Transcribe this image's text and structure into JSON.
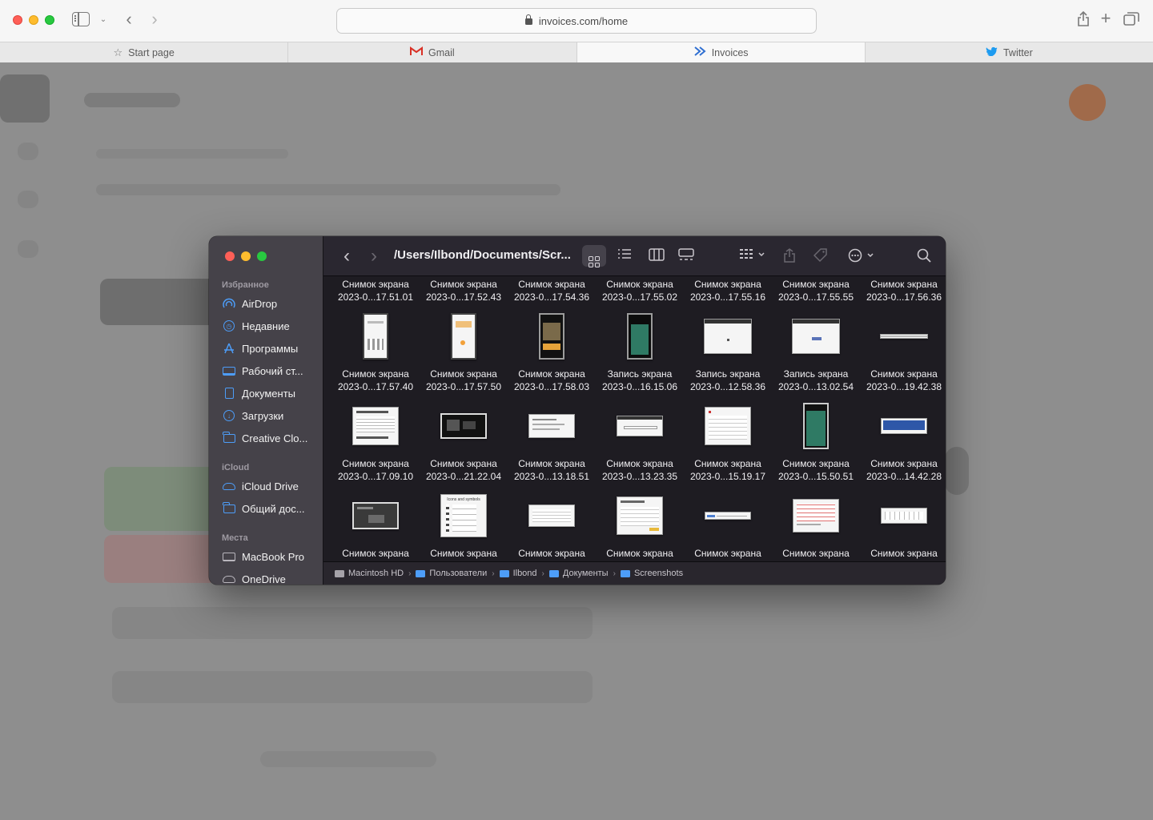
{
  "browser": {
    "url": "invoices.com/home",
    "tabs": [
      {
        "label": "Start page",
        "icon": "star-icon"
      },
      {
        "label": "Gmail",
        "icon": "gmail-icon"
      },
      {
        "label": "Invoices",
        "icon": "invoices-icon",
        "active": true
      },
      {
        "label": "Twitter",
        "icon": "twitter-icon"
      }
    ]
  },
  "finder": {
    "path_title": "/Users/Ilbond/Documents/Scr...",
    "sidebar": {
      "favorites_title": "Избранное",
      "favorites": [
        "AirDrop",
        "Недавние",
        "Программы",
        "Рабочий ст...",
        "Документы",
        "Загрузки",
        "Creative Clo..."
      ],
      "icloud_title": "iCloud",
      "icloud": [
        "iCloud Drive",
        "Общий дос..."
      ],
      "places_title": "Места",
      "places": [
        "MacBook Pro",
        "OneDrive"
      ]
    },
    "rows": [
      [
        {
          "title": "Снимок экрана",
          "sub": "2023-0...17.51.01"
        },
        {
          "title": "Снимок экрана",
          "sub": "2023-0...17.52.43"
        },
        {
          "title": "Снимок экрана",
          "sub": "2023-0...17.54.36"
        },
        {
          "title": "Снимок экрана",
          "sub": "2023-0...17.55.02"
        },
        {
          "title": "Снимок экрана",
          "sub": "2023-0...17.55.16"
        },
        {
          "title": "Снимок экрана",
          "sub": "2023-0...17.55.55"
        },
        {
          "title": "Снимок экрана",
          "sub": "2023-0...17.56.36"
        }
      ],
      [
        {
          "title": "Снимок экрана",
          "sub": "2023-0...17.57.40"
        },
        {
          "title": "Снимок экрана",
          "sub": "2023-0...17.57.50"
        },
        {
          "title": "Снимок экрана",
          "sub": "2023-0...17.58.03"
        },
        {
          "title": "Запись экрана",
          "sub": "2023-0...16.15.06"
        },
        {
          "title": "Запись экрана",
          "sub": "2023-0...12.58.36"
        },
        {
          "title": "Запись экрана",
          "sub": "2023-0...13.02.54"
        },
        {
          "title": "Снимок экрана",
          "sub": "2023-0...19.42.38"
        }
      ],
      [
        {
          "title": "Снимок экрана",
          "sub": "2023-0...17.09.10"
        },
        {
          "title": "Снимок экрана",
          "sub": "2023-0...21.22.04"
        },
        {
          "title": "Снимок экрана",
          "sub": "2023-0...13.18.51"
        },
        {
          "title": "Снимок экрана",
          "sub": "2023-0...13.23.35"
        },
        {
          "title": "Снимок экрана",
          "sub": "2023-0...15.19.17"
        },
        {
          "title": "Снимок экрана",
          "sub": "2023-0...15.50.51"
        },
        {
          "title": "Снимок экрана",
          "sub": "2023-0...14.42.28"
        }
      ],
      [
        {
          "title": "Снимок экрана",
          "sub": ""
        },
        {
          "title": "Снимок экрана",
          "sub": ""
        },
        {
          "title": "Снимок экрана",
          "sub": ""
        },
        {
          "title": "Снимок экрана",
          "sub": ""
        },
        {
          "title": "Снимок экрана",
          "sub": ""
        },
        {
          "title": "Снимок экрана",
          "sub": ""
        },
        {
          "title": "Снимок экрана",
          "sub": ""
        }
      ]
    ],
    "thumb_text": "Icons and symbols",
    "pathbar": [
      "Macintosh HD",
      "Пользователи",
      "Ilbond",
      "Документы",
      "Screenshots"
    ]
  },
  "colors": {
    "accent": "#4d9df8",
    "gmail_red": "#d93025",
    "twitter_blue": "#1d9bf0",
    "invoices_blue": "#2f6fd1"
  }
}
